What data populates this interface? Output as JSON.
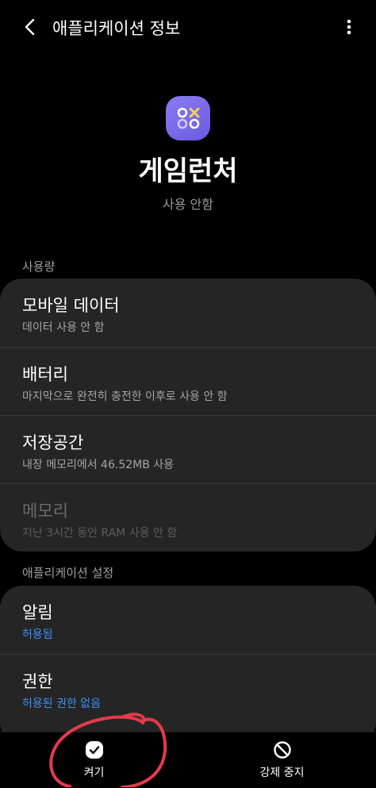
{
  "header": {
    "title": "애플리케이션 정보",
    "back_icon": "back-arrow-icon",
    "more_icon": "more-vertical-icon"
  },
  "app": {
    "name": "게임런처",
    "status": "사용 안함",
    "icon": "game-launcher-icon",
    "icon_color": "#7b6cf0"
  },
  "usage": {
    "section_label": "사용량",
    "items": [
      {
        "title": "모바일 데이터",
        "subtitle": "데이터 사용 안 함"
      },
      {
        "title": "배터리",
        "subtitle": "마지막으로 완전히 충전한 이후로 사용 안 함"
      },
      {
        "title": "저장공간",
        "subtitle": "내장 메모리에서 46.52MB 사용"
      },
      {
        "title": "메모리",
        "subtitle": "지난 3시간 동안 RAM 사용 안 함"
      }
    ]
  },
  "settings": {
    "section_label": "애플리케이션 설정",
    "items": [
      {
        "title": "알림",
        "subtitle": "허용됨"
      },
      {
        "title": "권한",
        "subtitle": "허용된 권한 없음"
      }
    ]
  },
  "bottom_bar": {
    "enable_label": "켜기",
    "force_stop_label": "강제 중지",
    "enable_icon": "check-circle-icon",
    "force_stop_icon": "block-icon"
  },
  "colors": {
    "background": "#000000",
    "card": "#252525",
    "link_blue": "#3e8ef7",
    "annotation_red": "#e63a4a"
  }
}
